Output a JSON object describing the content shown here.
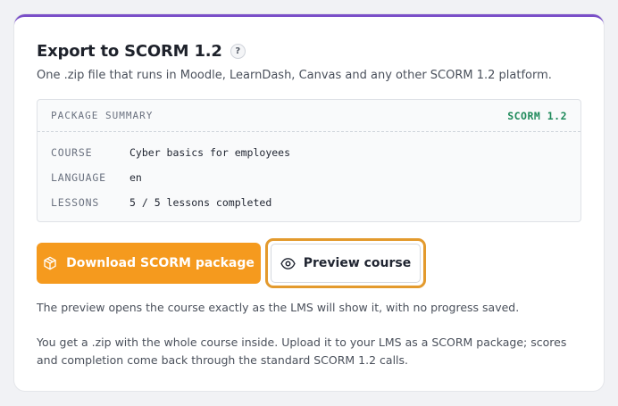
{
  "export": {
    "title": "Export to SCORM 1.2",
    "help_label": "?",
    "subtitle": "One .zip file that runs in Moodle, LearnDash, Canvas and any other SCORM 1.2 platform."
  },
  "summary": {
    "heading": "PACKAGE SUMMARY",
    "badge": "SCORM 1.2",
    "badge_color": "#1f8a5b",
    "rows": [
      {
        "key": "COURSE",
        "value": "Cyber basics for employees"
      },
      {
        "key": "LANGUAGE",
        "value": "en"
      },
      {
        "key": "LESSONS",
        "value": "5 / 5 lessons completed"
      }
    ]
  },
  "actions": {
    "download_label": "Download SCORM package",
    "download_icon": "package-icon",
    "preview_label": "Preview course",
    "preview_icon": "eye-icon",
    "accent_color": "#f59a1e"
  },
  "notes": {
    "preview_note": "The preview opens the course exactly as the LMS will show it, with no progress saved.",
    "upload_note": "You get a .zip with the whole course inside. Upload it to your LMS as a SCORM package; scores and completion come back through the standard SCORM 1.2 calls."
  }
}
